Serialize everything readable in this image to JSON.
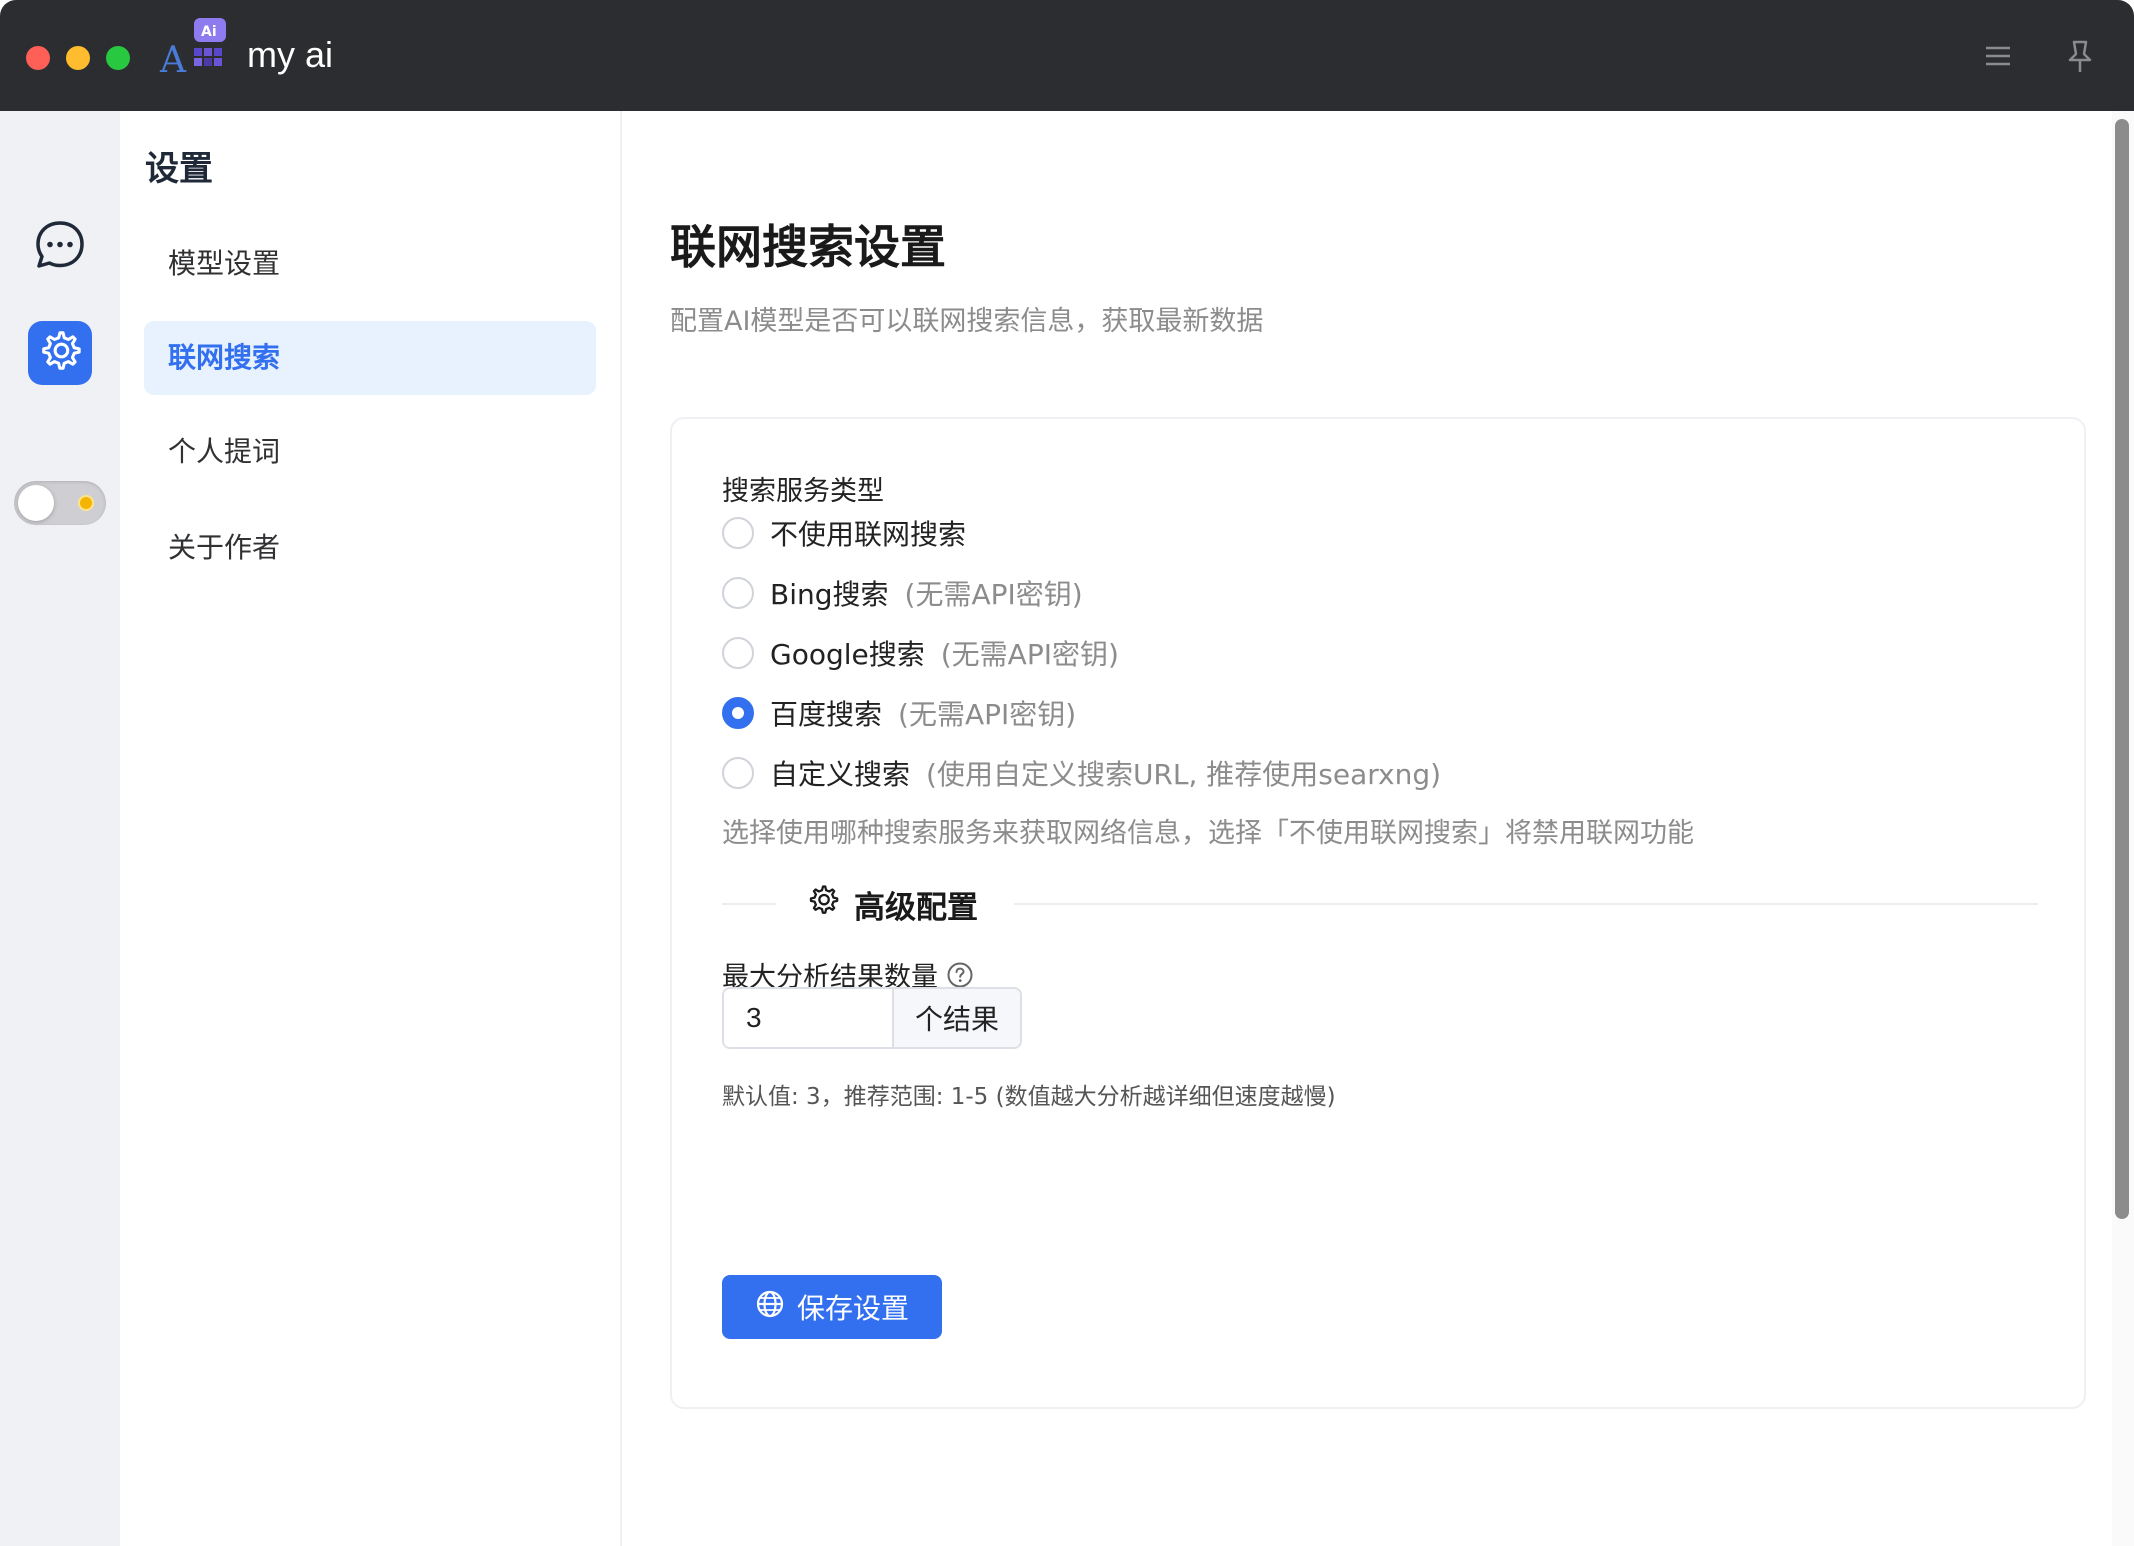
{
  "app": {
    "title": "my ai",
    "logo_badge": "Ai",
    "logo_letter": "A"
  },
  "rail": {
    "items": [
      {
        "icon": "chat-bubble-icon"
      },
      {
        "icon": "gear-icon",
        "active": true
      }
    ],
    "theme_toggle_icon": "sun-icon"
  },
  "nav": {
    "title": "设置",
    "items": [
      {
        "label": "模型设置"
      },
      {
        "label": "联网搜索",
        "active": true
      },
      {
        "label": "个人提词"
      },
      {
        "label": "关于作者"
      }
    ]
  },
  "main": {
    "title": "联网搜索设置",
    "subtitle": "配置AI模型是否可以联网搜索信息，获取最新数据",
    "search_type": {
      "label": "搜索服务类型",
      "options": [
        {
          "label": "不使用联网搜索",
          "hint": ""
        },
        {
          "label": "Bing搜索",
          "hint": "(无需API密钥)"
        },
        {
          "label": "Google搜索",
          "hint": "(无需API密钥)"
        },
        {
          "label": "百度搜索",
          "hint": "(无需API密钥)",
          "checked": true
        },
        {
          "label": "自定义搜索",
          "hint": "(使用自定义搜索URL, 推荐使用searxng)"
        }
      ],
      "help": "选择使用哪种搜索服务来获取网络信息，选择「不使用联网搜索」将禁用联网功能"
    },
    "advanced": {
      "title": "高级配置",
      "max_results_label": "最大分析结果数量",
      "max_results_value": "3",
      "max_results_suffix": "个结果",
      "max_results_note": "默认值: 3，推荐范围: 1-5 (数值越大分析越详细但速度越慢)"
    },
    "save_label": "保存设置"
  },
  "colors": {
    "accent": "#3370f0",
    "titlebar": "#2c2d30",
    "nav_active_bg": "#e8f2fe"
  }
}
